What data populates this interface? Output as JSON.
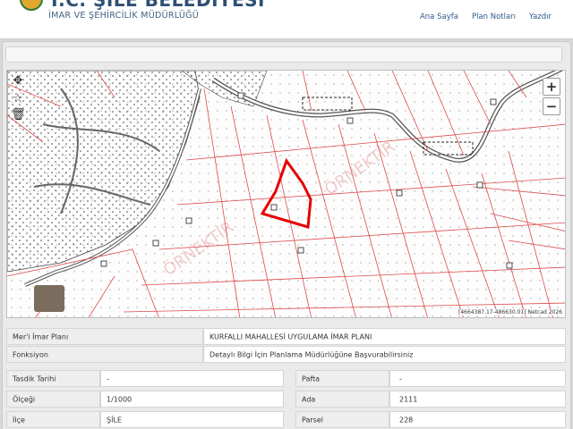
{
  "header": {
    "title": "T.C. ŞİLE BELEDİYESİ",
    "subtitle": "İMAR VE ŞEHİRCİLİK MÜDÜRLÜĞÜ",
    "nav": [
      "Ana Sayfa",
      "Plan Notları",
      "Yazdır"
    ]
  },
  "map": {
    "zoom_in": "+",
    "zoom_out": "−",
    "coords": "[4664387.17-486630.01]",
    "copyright": "Netcad 2026"
  },
  "info": {
    "meri_plan_label": "Mer'i İmar Planı",
    "meri_plan_value": "KURFALLI MAHALLESİ UYGULAMA İMAR PLANI",
    "fonksiyon_label": "Fonksiyon",
    "fonksiyon_value": "Detaylı Bilgi İçin Planlama Müdürlüğüne Başvurabilirsiniz",
    "tasdik_label": "Tasdik Tarihi",
    "tasdik_value": "-",
    "pafta_label": "Pafta",
    "pafta_value": "-",
    "olcek_label": "Ölçeği",
    "olcek_value": "1/1000",
    "ada_label": "Ada",
    "ada_value": "2111",
    "ilce_label": "İlçe",
    "ilce_value": "ŞİLE",
    "parsel_label": "Parsel",
    "parsel_value": "228"
  },
  "watermark": "ÖRNEKTİR",
  "colors": {
    "parcel_line": "#e04a4a",
    "selected_parcel": "#e60000",
    "road": "#555555",
    "header_text": "#2f4f74"
  }
}
